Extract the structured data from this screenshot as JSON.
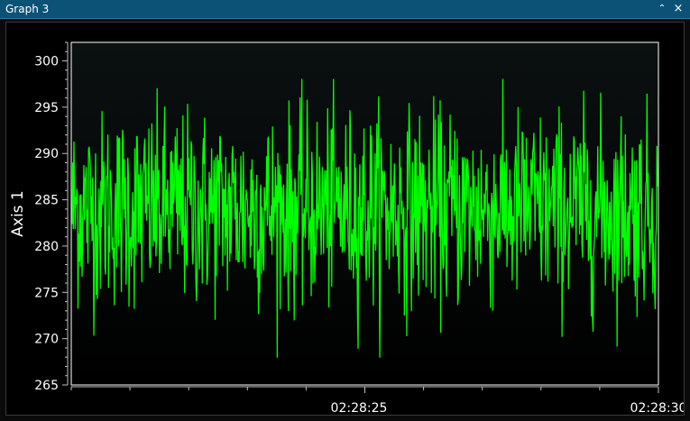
{
  "window": {
    "title": "Graph 3",
    "collapse_icon": "chevron-up-icon",
    "close_icon": "close-icon",
    "collapse_glyph": "⌃",
    "close_glyph": "×"
  },
  "colors": {
    "titlebar": "#0b5276",
    "plot_bg_top": "#080b0b",
    "plot_bg_bottom": "#000000",
    "series": "#00ff00",
    "axis_text": "#ffffff"
  },
  "chart_data": {
    "type": "line",
    "title": "",
    "ylabel": "Axis 1",
    "xlabel": "",
    "ylim": [
      265,
      302
    ],
    "yticks": [
      265,
      270,
      275,
      280,
      285,
      290,
      295,
      300
    ],
    "xlim": [
      "02:28:20",
      "02:28:30"
    ],
    "xtick_labels": [
      "02:28:25",
      "02:28:30"
    ],
    "grid": false,
    "series": [
      {
        "color": "#00ff00",
        "samples": 1000,
        "mean": 284,
        "min": 268,
        "max": 298,
        "note": "dense noisy signal"
      }
    ]
  }
}
